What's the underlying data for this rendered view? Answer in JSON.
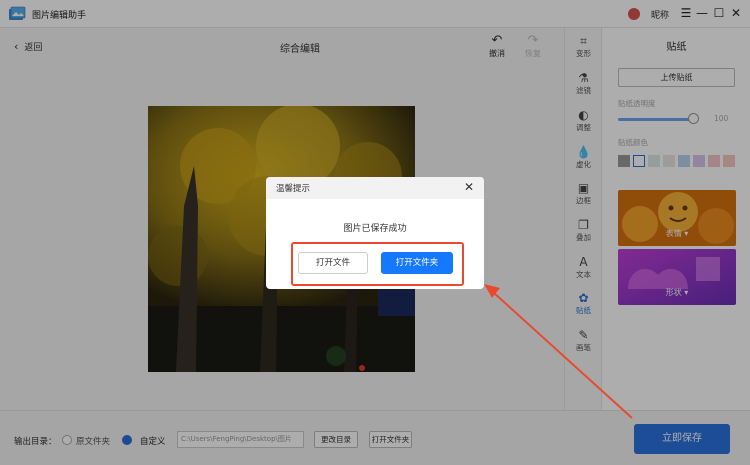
{
  "app": {
    "title": "图片编辑助手",
    "user_name": "昵称"
  },
  "window_controls": {
    "menu": "☰",
    "minimize": "—",
    "maximize": "☐",
    "close": "✕"
  },
  "toolbar": {
    "back_label": "返回",
    "page_title": "综合编辑",
    "undo_label": "撤消",
    "redo_label": "恢复"
  },
  "tools": [
    {
      "label": "变形",
      "icon": "transform-icon",
      "glyph": "⌗"
    },
    {
      "label": "滤镜",
      "icon": "filter-icon",
      "glyph": "⚗"
    },
    {
      "label": "调整",
      "icon": "adjust-icon",
      "glyph": "◐"
    },
    {
      "label": "虚化",
      "icon": "blur-icon",
      "glyph": "💧"
    },
    {
      "label": "边框",
      "icon": "border-icon",
      "glyph": "▣"
    },
    {
      "label": "叠加",
      "icon": "overlay-icon",
      "glyph": "❐"
    },
    {
      "label": "文本",
      "icon": "text-icon",
      "glyph": "A"
    },
    {
      "label": "贴纸",
      "icon": "sticker-icon",
      "glyph": "✿",
      "active": true
    },
    {
      "label": "画笔",
      "icon": "brush-icon",
      "glyph": "✎"
    }
  ],
  "sticker_panel": {
    "title": "贴纸",
    "upload_label": "上传贴纸",
    "opacity_label": "贴纸透明度",
    "opacity_value": "100",
    "color_label": "贴纸颜色",
    "swatches": [
      "#9a9a9a",
      "#ffffff",
      "#dfe9e4",
      "#e6e8e0",
      "#b9d2ec",
      "#d9c4ec",
      "#f3c4c4",
      "#f3c9bd"
    ],
    "card_labels": [
      "表情",
      "形状"
    ]
  },
  "bottom": {
    "output_label": "输出目录：",
    "option_original": "原文件夹",
    "option_custom": "自定义",
    "path_value": "C:\\Users\\FengPing\\Desktop\\图片",
    "change_dir_label": "更改目录",
    "open_folder_label": "打开文件夹",
    "save_label": "立即保存"
  },
  "dialog": {
    "title": "温馨提示",
    "message": "图片已保存成功",
    "open_file_label": "打开文件",
    "open_folder_label": "打开文件夹"
  }
}
